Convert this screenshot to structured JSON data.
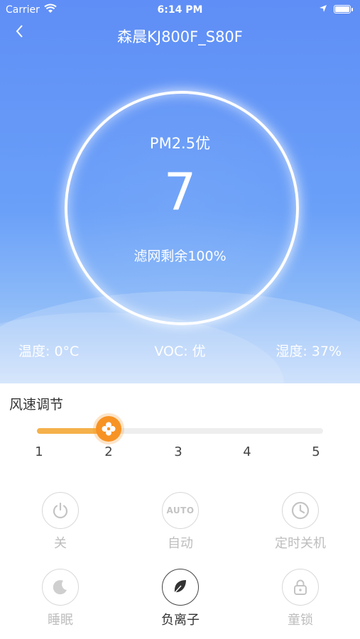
{
  "status_bar": {
    "carrier": "Carrier",
    "time": "6:14 PM"
  },
  "nav": {
    "back_icon": "chevron-left-icon",
    "title": "森晨KJ800F_S80F"
  },
  "air_quality": {
    "pm_label": "PM2.5优",
    "pm_value": "7",
    "filter_text": "滤网剩余100%"
  },
  "stats": {
    "temperature": "温度: 0°C",
    "voc": "VOC: 优",
    "humidity": "湿度: 37%"
  },
  "fan_speed": {
    "title": "风速调节",
    "ticks": [
      "1",
      "2",
      "3",
      "4",
      "5"
    ],
    "current": 2,
    "min": 1,
    "max": 5,
    "thumb_icon": "fan-icon"
  },
  "controls": [
    {
      "label": "关",
      "icon": "power-icon",
      "active": false
    },
    {
      "label": "自动",
      "icon": "auto-icon",
      "icon_text": "AUTO",
      "active": false
    },
    {
      "label": "定时关机",
      "icon": "clock-icon",
      "active": false
    },
    {
      "label": "睡眠",
      "icon": "moon-icon",
      "active": false
    },
    {
      "label": "负离子",
      "icon": "leaf-icon",
      "active": true
    },
    {
      "label": "童锁",
      "icon": "lock-icon",
      "active": false
    }
  ],
  "colors": {
    "accent": "#f79324",
    "hero_top": "#5f8ef6",
    "hero_bottom": "#c6dcfb"
  }
}
